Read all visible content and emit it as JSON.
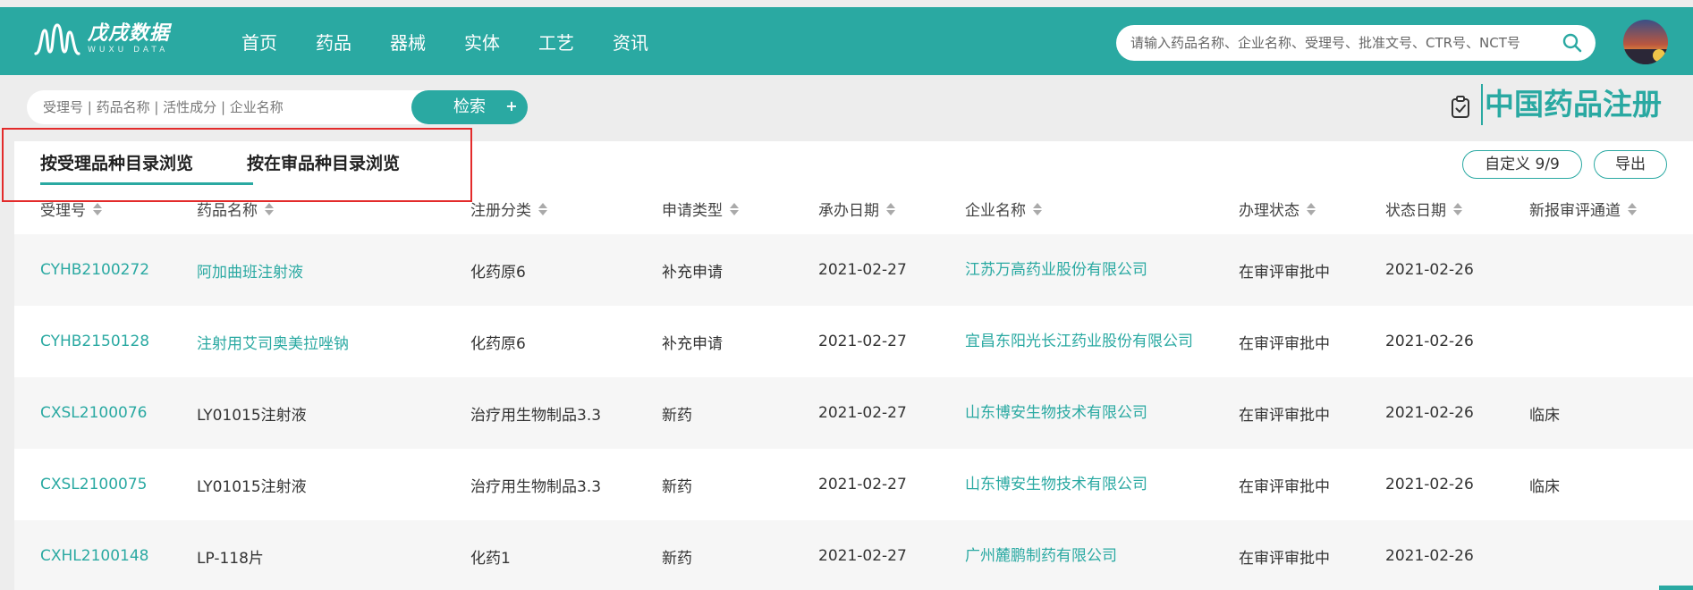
{
  "header": {
    "logo_cn": "戊戌数据",
    "logo_en": "WUXU DATA",
    "nav": [
      "首页",
      "药品",
      "器械",
      "实体",
      "工艺",
      "资讯"
    ],
    "search_placeholder": "请输入药品名称、企业名称、受理号、批准文号、CTR号、NCT号",
    "brand_color": "#2aa9a2"
  },
  "subsearch": {
    "placeholder": "受理号 | 药品名称 | 活性成分 | 企业名称",
    "button": "检索",
    "plus": "+"
  },
  "page_title": "中国药品注册",
  "tabs": [
    "按受理品种目录浏览",
    "按在审品种目录浏览"
  ],
  "active_tab": 0,
  "actions": {
    "custom": "自定义 9/9",
    "export": "导出"
  },
  "table": {
    "columns": [
      "受理号",
      "药品名称",
      "注册分类",
      "申请类型",
      "承办日期",
      "企业名称",
      "办理状态",
      "状态日期",
      "新报审评通道"
    ],
    "rows": [
      [
        "CYHB2100272",
        "阿加曲班注射液",
        "化药原6",
        "补充申请",
        "2021-02-27",
        "江苏万高药业股份有限公司",
        "在审评审批中",
        "2021-02-26",
        ""
      ],
      [
        "CYHB2150128",
        "注射用艾司奥美拉唑钠",
        "化药原6",
        "补充申请",
        "2021-02-27",
        "宜昌东阳光长江药业股份有限公司",
        "在审评审批中",
        "2021-02-26",
        ""
      ],
      [
        "CXSL2100076",
        "LY01015注射液",
        "治疗用生物制品3.3",
        "新药",
        "2021-02-27",
        "山东博安生物技术有限公司",
        "在审评审批中",
        "2021-02-26",
        "临床"
      ],
      [
        "CXSL2100075",
        "LY01015注射液",
        "治疗用生物制品3.3",
        "新药",
        "2021-02-27",
        "山东博安生物技术有限公司",
        "在审评审批中",
        "2021-02-26",
        "临床"
      ],
      [
        "CXHL2100148",
        "LP-118片",
        "化药1",
        "新药",
        "2021-02-27",
        "广州麓鹏制药有限公司",
        "在审评审批中",
        "2021-02-26",
        ""
      ]
    ]
  },
  "icons": {
    "search": "search-icon",
    "register": "clipboard-check-icon",
    "sort": "sort-arrows-icon"
  }
}
